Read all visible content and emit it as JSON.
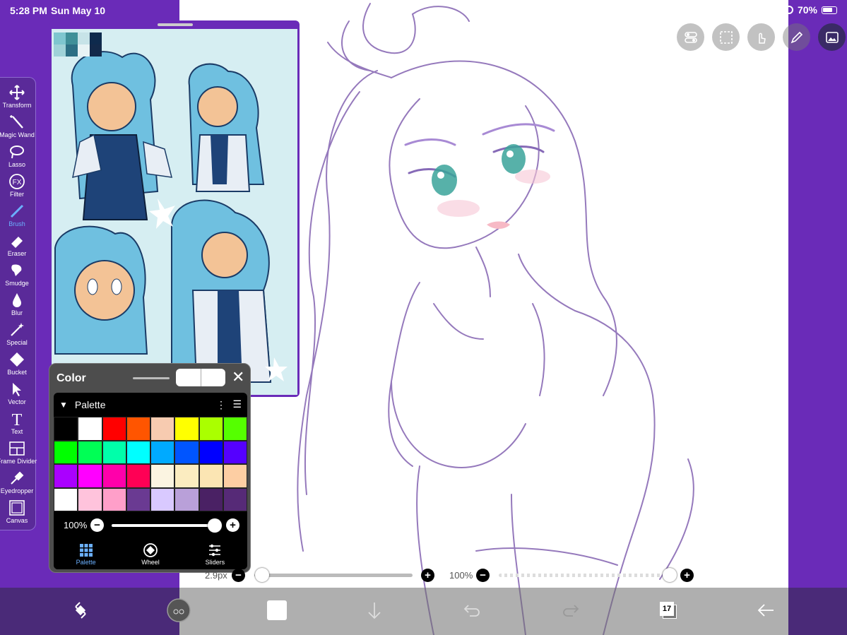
{
  "status_bar": {
    "time": "5:28 PM",
    "date": "Sun May 10",
    "battery": "70%"
  },
  "top_tools": [
    "layer-toggle-icon",
    "selection-icon",
    "touch-icon",
    "pen-icon",
    "image-icon"
  ],
  "toolbar": {
    "items": [
      {
        "label": "Transform",
        "icon": "move-icon"
      },
      {
        "label": "Magic Wand",
        "icon": "magic-wand-icon"
      },
      {
        "label": "Lasso",
        "icon": "lasso-icon"
      },
      {
        "label": "Filter",
        "icon": "fx-icon"
      },
      {
        "label": "Brush",
        "icon": "brush-icon"
      },
      {
        "label": "Eraser",
        "icon": "eraser-icon"
      },
      {
        "label": "Smudge",
        "icon": "smudge-icon"
      },
      {
        "label": "Blur",
        "icon": "blur-icon"
      },
      {
        "label": "Special",
        "icon": "special-icon"
      },
      {
        "label": "Bucket",
        "icon": "bucket-icon"
      },
      {
        "label": "Vector",
        "icon": "vector-icon"
      },
      {
        "label": "Text",
        "icon": "text-icon"
      },
      {
        "label": "Frame Divider",
        "icon": "frame-divider-icon"
      },
      {
        "label": "Eyedropper",
        "icon": "eyedropper-icon"
      },
      {
        "label": "Canvas",
        "icon": "canvas-icon"
      }
    ],
    "active": "Brush"
  },
  "reference": {
    "swatches": [
      "#7ec6cf",
      "#3f8f98",
      "#c7e3e8",
      "#0e2a4d",
      "#9fd2d8",
      "#2c6f84",
      "#e8f3f5",
      "#13294a"
    ]
  },
  "color_panel": {
    "title": "Color",
    "palette_title": "Palette",
    "palette": [
      "#000000",
      "#ffffff",
      "#ff0000",
      "#ff5500",
      "#f7cbb0",
      "#ffff00",
      "#aaff00",
      "#55ff00",
      "#00ff00",
      "#00ff55",
      "#00ffaa",
      "#00ffff",
      "#00aaff",
      "#0055ff",
      "#0000ff",
      "#5500ff",
      "#aa00ff",
      "#ff00ff",
      "#ff00aa",
      "#ff0055",
      "#fbf4e1",
      "#fbecc0",
      "#fbe5b3",
      "#fdcea3",
      "#ffffff",
      "#ffc3dc",
      "#ff9fc9",
      "#6a3a92",
      "#d9c9ff",
      "#b9a0d9",
      "#4a2164",
      "#562a77"
    ],
    "opacity": "100%",
    "tabs": [
      {
        "label": "Palette",
        "icon": "palette-grid-icon"
      },
      {
        "label": "Wheel",
        "icon": "color-wheel-icon"
      },
      {
        "label": "Sliders",
        "icon": "sliders-icon"
      }
    ]
  },
  "brush": {
    "size": "2.9px",
    "opacity": "100%"
  },
  "bottom_bar": {
    "layer_count": "17"
  }
}
